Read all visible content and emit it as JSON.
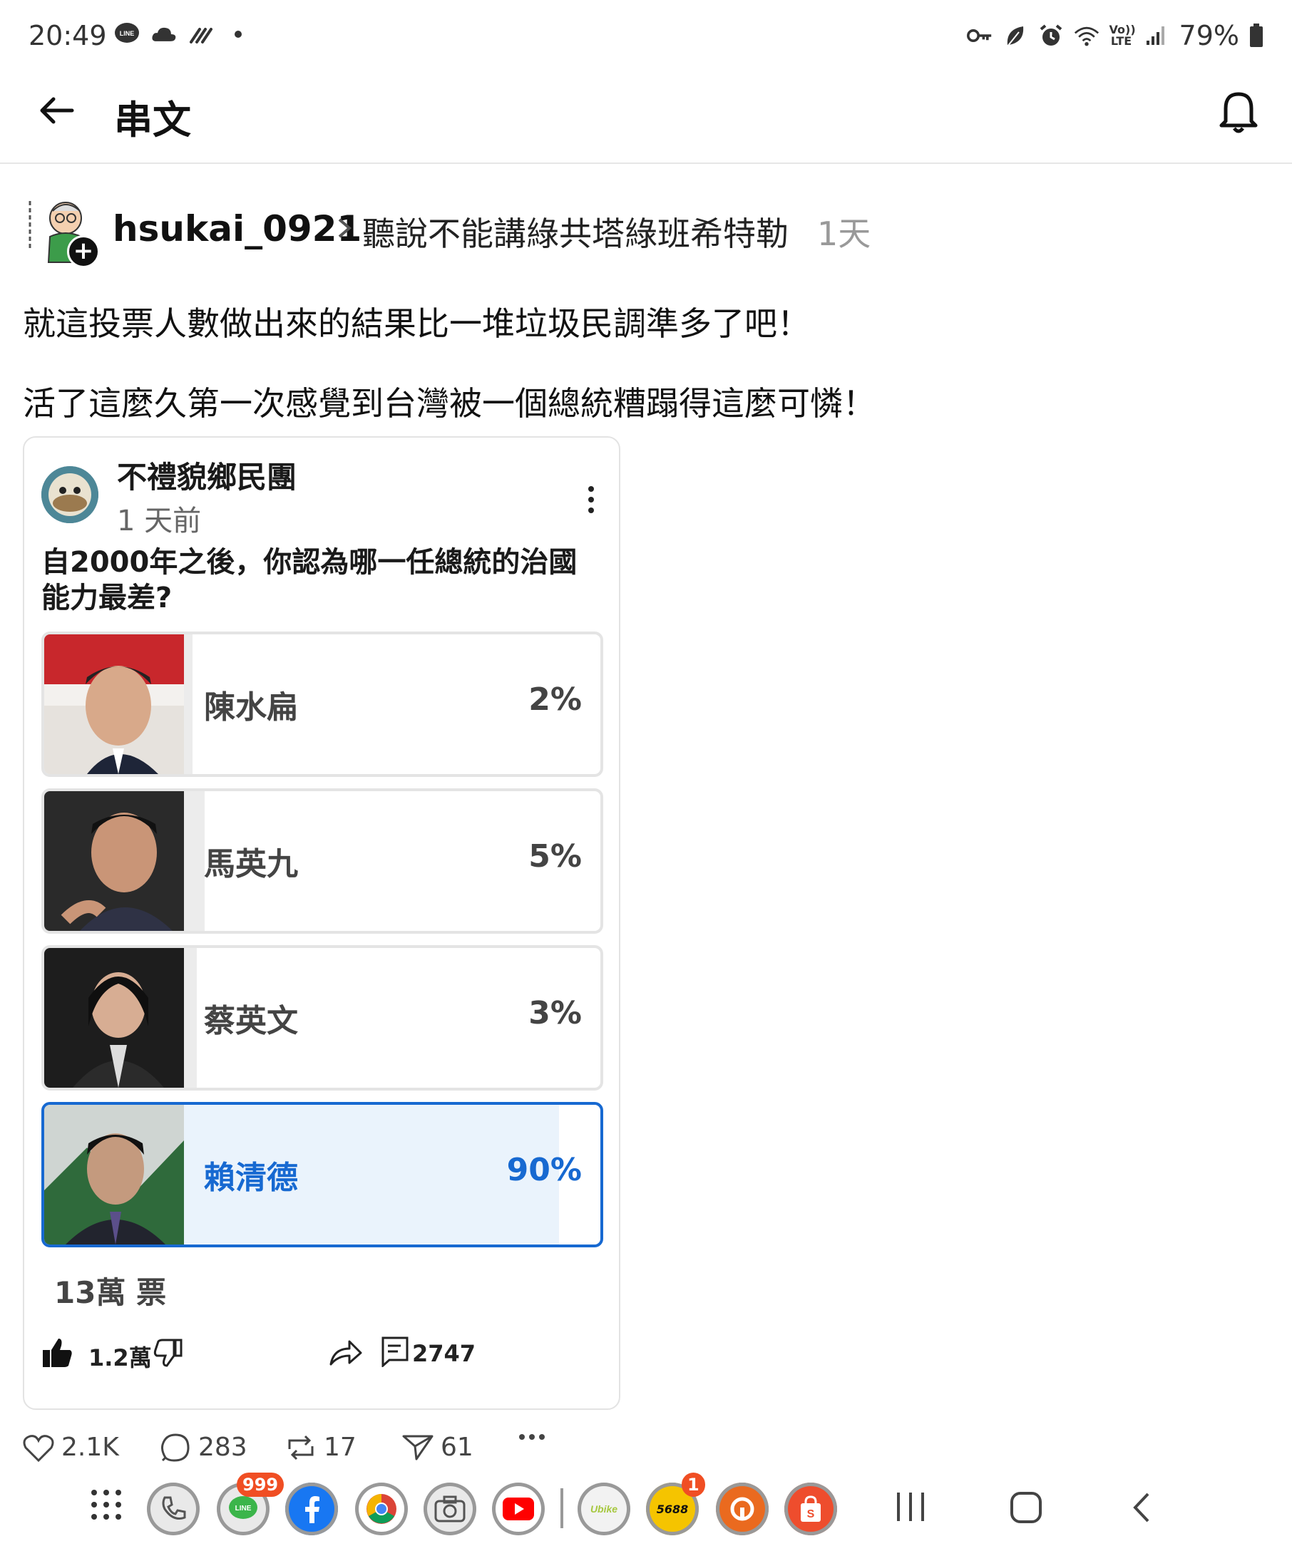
{
  "status": {
    "time": "20:49",
    "battery": "79%",
    "network": "Vo)) LTE"
  },
  "header": {
    "title": "串文",
    "back_icon": "arrow-left-icon",
    "bell_icon": "bell-icon"
  },
  "post": {
    "username": "hsukai_0921",
    "topic": "聽說不能講綠共塔綠班希特勒",
    "time_ago": "1天",
    "lines": [
      "就這投票人數做出來的結果比一堆垃圾民調準多了吧！",
      "活了這麼久第一次感覺到台灣被一個總統糟蹋得這麼可憐！"
    ]
  },
  "card": {
    "author": "不禮貌鄉民團",
    "time": "1 天前",
    "question": "自2000年之後，你認為哪一任總統的治國能力最差?",
    "options": [
      {
        "name": "陳水扁",
        "pct": "2%",
        "value": 0.02
      },
      {
        "name": "馬英九",
        "pct": "5%",
        "value": 0.05
      },
      {
        "name": "蔡英文",
        "pct": "3%",
        "value": 0.03
      },
      {
        "name": "賴清德",
        "pct": "90%",
        "value": 0.9,
        "selected": true
      }
    ],
    "votes": "13萬 票",
    "likes": "1.2萬",
    "comments": "2747"
  },
  "engagement": {
    "likes": "2.1K",
    "comments": "283",
    "reposts": "17",
    "shares": "61"
  },
  "navbar": {
    "line_badge": "999",
    "app_56_badge": "1",
    "app_56_label": "5688"
  },
  "colors": {
    "accent": "#1769d1",
    "selected_fill": "#eaf3fc",
    "option_fill": "#ececec"
  }
}
